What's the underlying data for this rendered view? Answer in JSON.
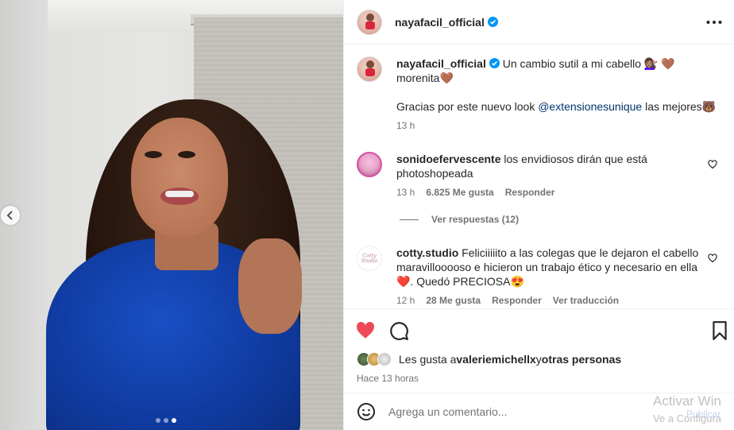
{
  "post": {
    "author": "nayafacil_official",
    "carousel_dots": 3,
    "carousel_active": 2
  },
  "caption": {
    "username": "nayafacil_official",
    "text_line1": "Un cambio sutil a mi cabello 💇🏽‍♀️ 🤎",
    "text_line2": "morenita🤎",
    "text_line3_pre": "Gracias por este nuevo look ",
    "mention": "@extensionesunique",
    "text_line3_post": " las mejores🐻",
    "time": "13 h"
  },
  "comments": [
    {
      "username": "sonidoefervescente",
      "text_line1": " los envidiosos dirán que está",
      "text_line2": "photoshopeada",
      "time": "13 h",
      "likes": "6.825 Me gusta",
      "reply": "Responder",
      "view_replies": "Ver respuestas (12)"
    },
    {
      "username": "cotty.studio",
      "avatar_text": "Cotty Studio",
      "text_line1": " Feliciiiiito a las colegas que le dejaron el cabello",
      "text_line2": "maravillooooso e hicieron un trabajo ético y necesario en ella",
      "text_line3": "❤️. Quedó PRECIOSA😍",
      "time": "12 h",
      "likes": "28 Me gusta",
      "reply": "Responder",
      "translate": "Ver traducción"
    }
  ],
  "likes": {
    "prefix": "Les gusta a ",
    "user": "valeriemichellx",
    "middle": " y ",
    "others": "otras personas"
  },
  "time_ago": "Hace 13 horas",
  "add_comment": {
    "placeholder": "Agrega un comentario...",
    "publish": "Publicar"
  },
  "watermark": {
    "line1": "Activar Win",
    "line2": "Ve a Configura"
  },
  "colors": {
    "heart_active": "#ed4956",
    "verified": "#0095f6",
    "link": "#00376b"
  }
}
